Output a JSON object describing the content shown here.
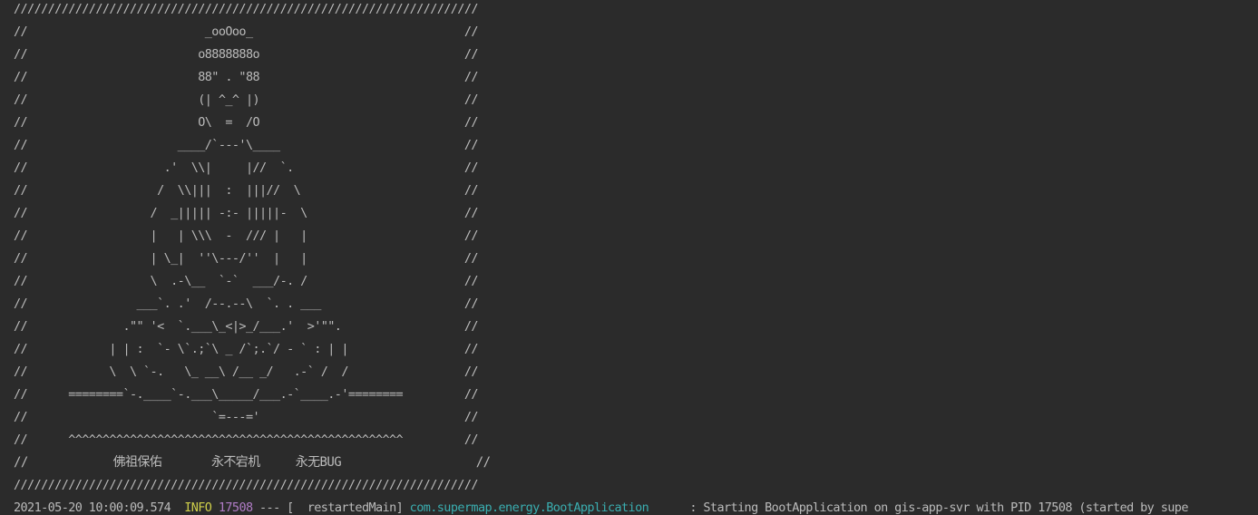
{
  "console": {
    "banner_lines": [
      "////////////////////////////////////////////////////////////////////",
      "//                          _ooOoo_                               //",
      "//                         o8888888o                              //",
      "//                         88\" . \"88                              //",
      "//                         (| ^_^ |)                              //",
      "//                         O\\  =  /O                              //",
      "//                      ____/`---'\\____                           //",
      "//                    .'  \\\\|     |//  `.                         //",
      "//                   /  \\\\|||  :  |||//  \\                        //",
      "//                  /  _||||| -:- |||||-  \\                       //",
      "//                  |   | \\\\\\  -  /// |   |                       //",
      "//                  | \\_|  ''\\---/''  |   |                       //",
      "//                  \\  .-\\__  `-`  ___/-. /                       //",
      "//                ___`. .'  /--.--\\  `. . ___                     //",
      "//              .\"\" '<  `.___\\_<|>_/___.'  >'\"\".                  //",
      "//            | | :  `- \\`.;`\\ _ /`;.`/ - ` : | |                 //",
      "//            \\  \\ `-.   \\_ __\\ /__ _/   .-` /  /                 //",
      "//      ========`-.____`-.___\\_____/___.-`____.-'========         //",
      "//                           `=---='                              //",
      "//      ^^^^^^^^^^^^^^^^^^^^^^^^^^^^^^^^^^^^^^^^^^^^^^^^^         //",
      "//            佛祖保佑       永不宕机     永无BUG                   //",
      "////////////////////////////////////////////////////////////////////"
    ],
    "log": {
      "timestamp": "2021-05-20 10:00:09.574",
      "level": "INFO",
      "pid": "17508",
      "separator": "---",
      "thread": "[  restartedMain]",
      "logger": "com.supermap.energy.BootApplication",
      "message": ": Starting BootApplication on gis-app-svr with PID 17508 (started by supe"
    },
    "colors": {
      "background": "#2b2b2b",
      "text": "#bbbbbb",
      "level": "#cfcf4a",
      "pid": "#b07cc6",
      "logger": "#3aaeb0"
    }
  }
}
